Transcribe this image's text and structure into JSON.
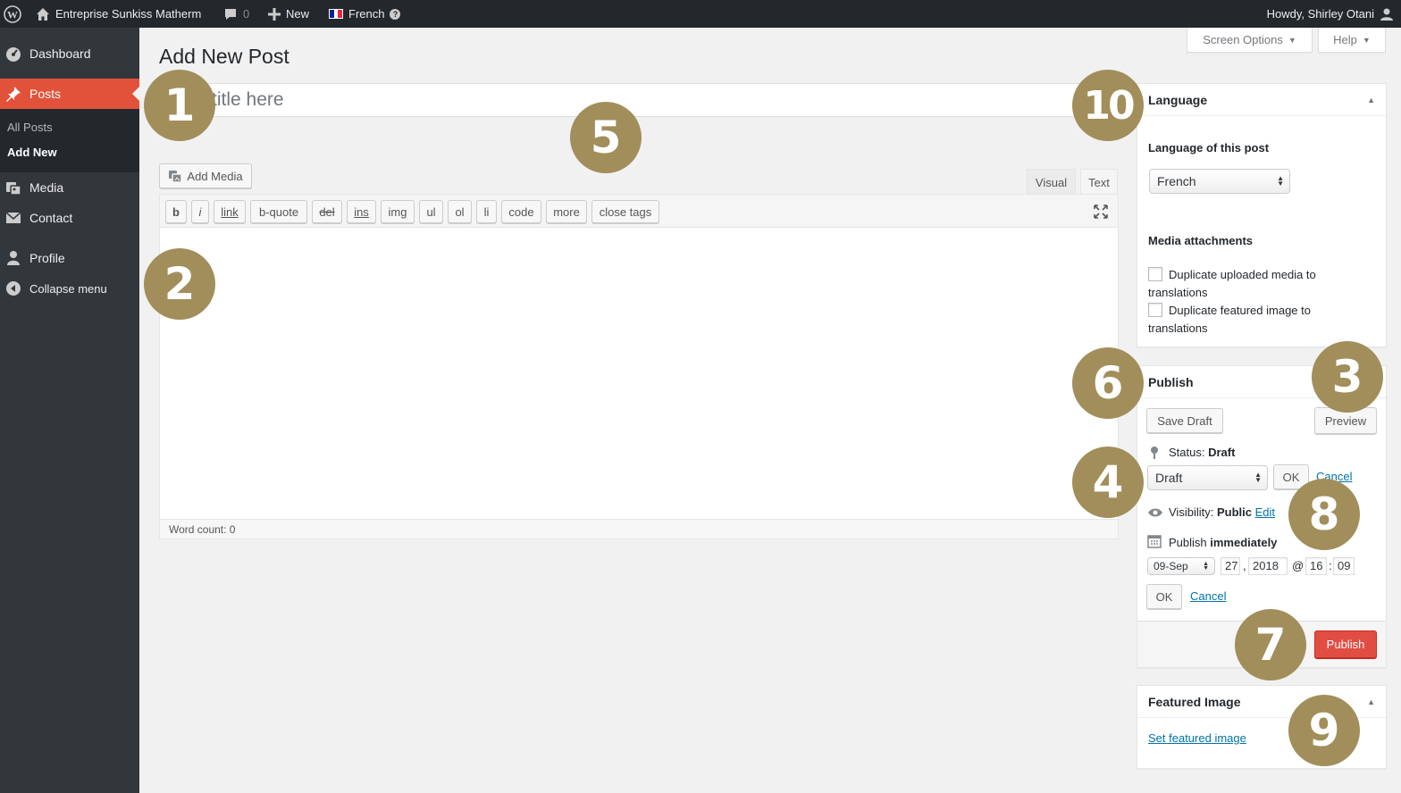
{
  "admin_bar": {
    "site_name": "Entreprise Sunkiss Matherm",
    "comments_count": "0",
    "new_label": "New",
    "language": "French",
    "help_glyph": "?",
    "greeting": "Howdy, Shirley Otani"
  },
  "sidebar": {
    "dashboard": "Dashboard",
    "posts": "Posts",
    "all_posts": "All Posts",
    "add_new": "Add New",
    "media": "Media",
    "contact": "Contact",
    "profile": "Profile",
    "collapse": "Collapse menu"
  },
  "top_buttons": {
    "screen_options": "Screen Options",
    "help": "Help",
    "caret": "▼"
  },
  "page_title": "Add New Post",
  "title_field": {
    "placeholder": "Enter title here",
    "visible_placeholder": "title here"
  },
  "editor": {
    "add_media": "Add Media",
    "tab_visual": "Visual",
    "tab_text": "Text",
    "quicktags": [
      "b",
      "i",
      "link",
      "b-quote",
      "del",
      "ins",
      "img",
      "ul",
      "ol",
      "li",
      "code",
      "more",
      "close tags"
    ],
    "word_count": "Word count: 0"
  },
  "language_box": {
    "title": "Language",
    "toggle": "▲",
    "language_label": "Language of this post",
    "language_value": "French",
    "media_heading": "Media attachments",
    "dup_media_1": "Duplicate uploaded media to",
    "dup_media_2": "translations",
    "dup_featured_1": "Duplicate featured image to",
    "dup_featured_2": "translations"
  },
  "publish_box": {
    "title": "Publish",
    "save_draft": "Save Draft",
    "preview": "Preview",
    "status_label": "Status:",
    "status_value": "Draft",
    "status_select": "Draft",
    "ok": "OK",
    "cancel": "Cancel",
    "visibility_label": "Visibility:",
    "visibility_value": "Public",
    "edit": "Edit",
    "publish_label": "Publish",
    "publish_value": "immediately",
    "month": "09-Sep",
    "day": "27",
    "year": "2018",
    "hour": "16",
    "minute": "09",
    "comma": ",",
    "at": "@",
    "colon": ":",
    "ok2": "OK",
    "cancel2": "Cancel",
    "publish_button": "Publish"
  },
  "featured_box": {
    "title": "Featured Image",
    "toggle": "▲",
    "set_link": "Set featured image"
  },
  "badges": [
    "1",
    "2",
    "3",
    "4",
    "5",
    "6",
    "7",
    "8",
    "9",
    "10"
  ],
  "colors": {
    "accent": "#e2523a",
    "badge": "#a18e5a",
    "publish": "#e14d43",
    "link": "#0073aa"
  }
}
